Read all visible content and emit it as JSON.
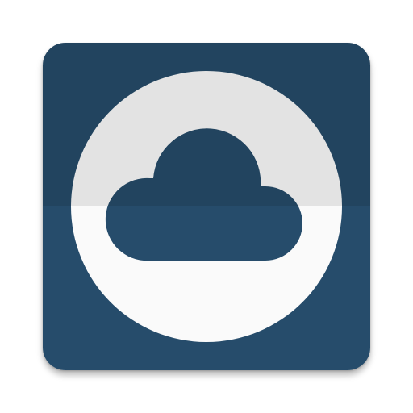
{
  "app_icon": {
    "name": "cloud-app-icon",
    "icon": "cloud-icon",
    "colors": {
      "tile_top": "#22445f",
      "tile_bottom": "#264c6b",
      "disc_top": "#e3e3e3",
      "disc_bottom": "#fafafa",
      "cloud_top": "#22445f",
      "cloud_bottom": "#264c6b"
    }
  }
}
